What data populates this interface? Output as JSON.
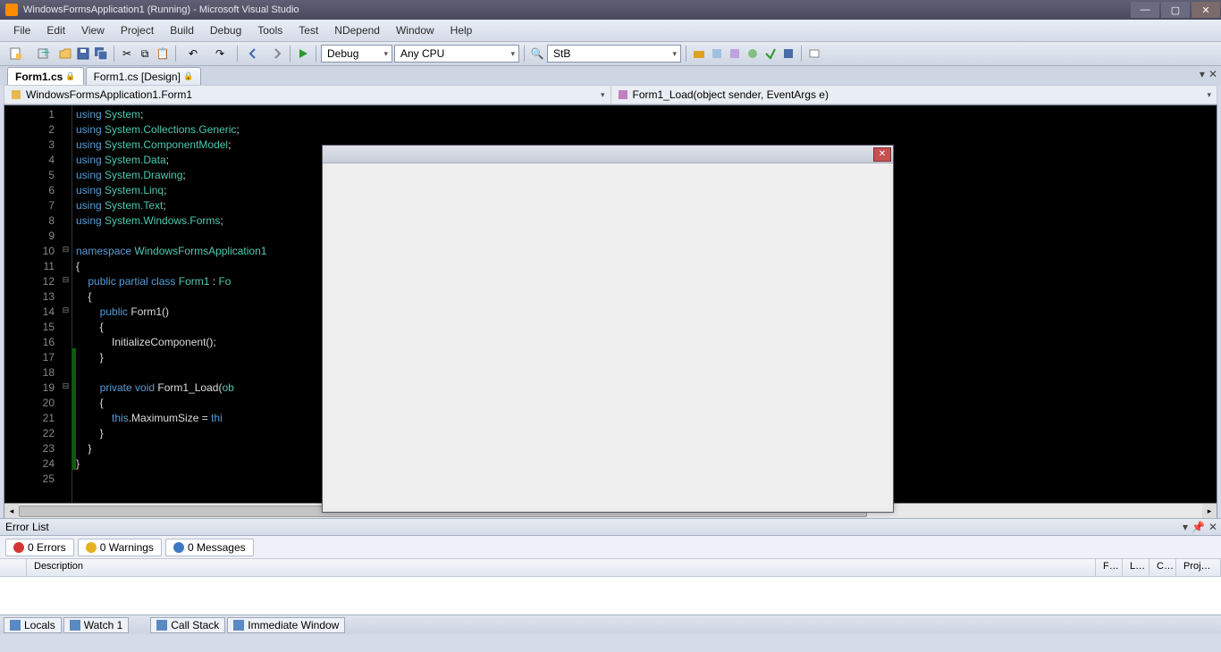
{
  "title": "WindowsFormsApplication1 (Running) - Microsoft Visual Studio",
  "menu": [
    "File",
    "Edit",
    "View",
    "Project",
    "Build",
    "Debug",
    "Tools",
    "Test",
    "NDepend",
    "Window",
    "Help"
  ],
  "toolbar": {
    "config": "Debug",
    "platform": "Any CPU",
    "search": "StB"
  },
  "tabs": [
    {
      "label": "Form1.cs",
      "locked": true,
      "active": true
    },
    {
      "label": "Form1.cs [Design]",
      "locked": true,
      "active": false
    }
  ],
  "nav": {
    "class": "WindowsFormsApplication1.Form1",
    "member": "Form1_Load(object sender, EventArgs e)"
  },
  "code": {
    "lines": [
      {
        "n": 1,
        "out": "",
        "chg": "",
        "tok": [
          [
            "kw",
            "using"
          ],
          [
            "op",
            " "
          ],
          [
            "ty",
            "System"
          ],
          [
            "op",
            ";"
          ]
        ]
      },
      {
        "n": 2,
        "out": "",
        "chg": "",
        "tok": [
          [
            "kw",
            "using"
          ],
          [
            "op",
            " "
          ],
          [
            "ty",
            "System.Collections.Generic"
          ],
          [
            "op",
            ";"
          ]
        ]
      },
      {
        "n": 3,
        "out": "",
        "chg": "",
        "tok": [
          [
            "kw",
            "using"
          ],
          [
            "op",
            " "
          ],
          [
            "ty",
            "System.ComponentModel"
          ],
          [
            "op",
            ";"
          ]
        ]
      },
      {
        "n": 4,
        "out": "",
        "chg": "",
        "tok": [
          [
            "kw",
            "using"
          ],
          [
            "op",
            " "
          ],
          [
            "ty",
            "System.Data"
          ],
          [
            "op",
            ";"
          ]
        ]
      },
      {
        "n": 5,
        "out": "",
        "chg": "",
        "tok": [
          [
            "kw",
            "using"
          ],
          [
            "op",
            " "
          ],
          [
            "ty",
            "System.Drawing"
          ],
          [
            "op",
            ";"
          ]
        ]
      },
      {
        "n": 6,
        "out": "",
        "chg": "",
        "tok": [
          [
            "kw",
            "using"
          ],
          [
            "op",
            " "
          ],
          [
            "ty",
            "System.Linq"
          ],
          [
            "op",
            ";"
          ]
        ]
      },
      {
        "n": 7,
        "out": "",
        "chg": "",
        "tok": [
          [
            "kw",
            "using"
          ],
          [
            "op",
            " "
          ],
          [
            "ty",
            "System.Text"
          ],
          [
            "op",
            ";"
          ]
        ]
      },
      {
        "n": 8,
        "out": "",
        "chg": "",
        "tok": [
          [
            "kw",
            "using"
          ],
          [
            "op",
            " "
          ],
          [
            "ty",
            "System.Windows.Forms"
          ],
          [
            "op",
            ";"
          ]
        ]
      },
      {
        "n": 9,
        "out": "",
        "chg": "",
        "tok": []
      },
      {
        "n": 10,
        "out": "⊟",
        "chg": "",
        "tok": [
          [
            "kw",
            "namespace"
          ],
          [
            "op",
            " "
          ],
          [
            "ty",
            "WindowsFormsApplication1"
          ]
        ]
      },
      {
        "n": 11,
        "out": "",
        "chg": "",
        "tok": [
          [
            "op",
            "{"
          ]
        ]
      },
      {
        "n": 12,
        "out": "⊟",
        "chg": "",
        "tok": [
          [
            "op",
            "    "
          ],
          [
            "kw",
            "public"
          ],
          [
            "op",
            " "
          ],
          [
            "kw",
            "partial"
          ],
          [
            "op",
            " "
          ],
          [
            "kw",
            "class"
          ],
          [
            "op",
            " "
          ],
          [
            "ty",
            "Form1"
          ],
          [
            "op",
            " : "
          ],
          [
            "ty",
            "Fo"
          ]
        ]
      },
      {
        "n": 13,
        "out": "",
        "chg": "",
        "tok": [
          [
            "op",
            "    {"
          ]
        ]
      },
      {
        "n": 14,
        "out": "⊟",
        "chg": "",
        "tok": [
          [
            "op",
            "        "
          ],
          [
            "kw",
            "public"
          ],
          [
            "op",
            " "
          ],
          [
            "fn",
            "Form1"
          ],
          [
            "op",
            "()"
          ]
        ]
      },
      {
        "n": 15,
        "out": "",
        "chg": "",
        "tok": [
          [
            "op",
            "        {"
          ]
        ]
      },
      {
        "n": 16,
        "out": "",
        "chg": "",
        "tok": [
          [
            "op",
            "            "
          ],
          [
            "fn",
            "InitializeComponent"
          ],
          [
            "op",
            "();"
          ]
        ]
      },
      {
        "n": 17,
        "out": "",
        "chg": "g",
        "tok": [
          [
            "op",
            "        }"
          ]
        ]
      },
      {
        "n": 18,
        "out": "",
        "chg": "g",
        "tok": []
      },
      {
        "n": 19,
        "out": "⊟",
        "chg": "g",
        "tok": [
          [
            "op",
            "        "
          ],
          [
            "kw",
            "private"
          ],
          [
            "op",
            " "
          ],
          [
            "kw",
            "void"
          ],
          [
            "op",
            " "
          ],
          [
            "fn",
            "Form1_Load"
          ],
          [
            "op",
            "("
          ],
          [
            "ty",
            "ob"
          ]
        ]
      },
      {
        "n": 20,
        "out": "",
        "chg": "g",
        "tok": [
          [
            "op",
            "        {"
          ]
        ]
      },
      {
        "n": 21,
        "out": "",
        "chg": "g",
        "tok": [
          [
            "op",
            "            "
          ],
          [
            "this",
            "this"
          ],
          [
            "op",
            ".MaximumSize = "
          ],
          [
            "this",
            "thi"
          ]
        ]
      },
      {
        "n": 22,
        "out": "",
        "chg": "g",
        "tok": [
          [
            "op",
            "        }"
          ]
        ]
      },
      {
        "n": 23,
        "out": "",
        "chg": "g",
        "tok": [
          [
            "op",
            "    }"
          ]
        ]
      },
      {
        "n": 24,
        "out": "",
        "chg": "g",
        "tok": [
          [
            "op",
            "}"
          ]
        ]
      },
      {
        "n": 25,
        "out": "",
        "chg": "",
        "tok": []
      }
    ]
  },
  "errorlist": {
    "title": "Error List",
    "errors": "0 Errors",
    "warnings": "0 Warnings",
    "messages": "0 Messages",
    "cols": {
      "desc": "Description",
      "f": "F…",
      "l": "L…",
      "c": "C…",
      "p": "Proj…"
    }
  },
  "bottom_tabs": {
    "locals": "Locals",
    "watch": "Watch 1",
    "callstack": "Call Stack",
    "immediate": "Immediate Window"
  }
}
